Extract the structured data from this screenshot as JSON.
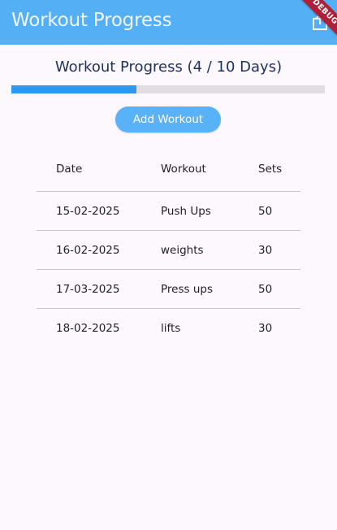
{
  "app_bar": {
    "title": "Workout Progress",
    "background": "#55aff5",
    "export_icon": "export-icon",
    "debug_banner": "DEBUG"
  },
  "progress": {
    "heading": "Workout Progress (4 / 10 Days)",
    "completed": 4,
    "total": 10,
    "fraction": 0.4,
    "fill_color": "#2f97ec"
  },
  "actions": {
    "add_workout_label": "Add Workout"
  },
  "table": {
    "headers": [
      "Date",
      "Workout",
      "Sets"
    ],
    "rows": [
      [
        "15-02-2025",
        "Push Ups",
        "50"
      ],
      [
        "16-02-2025",
        "weights",
        "30"
      ],
      [
        "17-03-2025",
        "Press ups",
        "50"
      ],
      [
        "18-02-2025",
        "lifts",
        "30"
      ]
    ]
  }
}
